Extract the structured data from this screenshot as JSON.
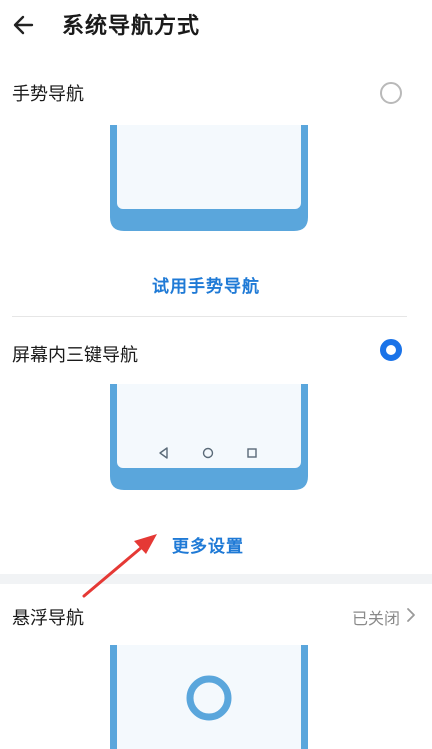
{
  "header": {
    "title": "系统导航方式",
    "back_icon": "arrow-left-icon"
  },
  "options": [
    {
      "id": "gesture",
      "title": "手势导航",
      "selected": false,
      "action_label": "试用手势导航"
    },
    {
      "id": "three-key",
      "title": "屏幕内三键导航",
      "selected": true,
      "action_label": "更多设置"
    }
  ],
  "floating": {
    "title": "悬浮导航",
    "status": "已关闭"
  },
  "colors": {
    "accent": "#1a73e8",
    "link": "#1f7ad6",
    "phone_frame": "#5aa6dc",
    "phone_screen": "#f4f9fd",
    "annotation_arrow": "#e53935"
  },
  "icons": [
    "arrow-left-icon",
    "radio-icon",
    "back-triangle-icon",
    "home-circle-icon",
    "recents-square-icon",
    "chevron-right-icon",
    "floating-dock-icon"
  ]
}
